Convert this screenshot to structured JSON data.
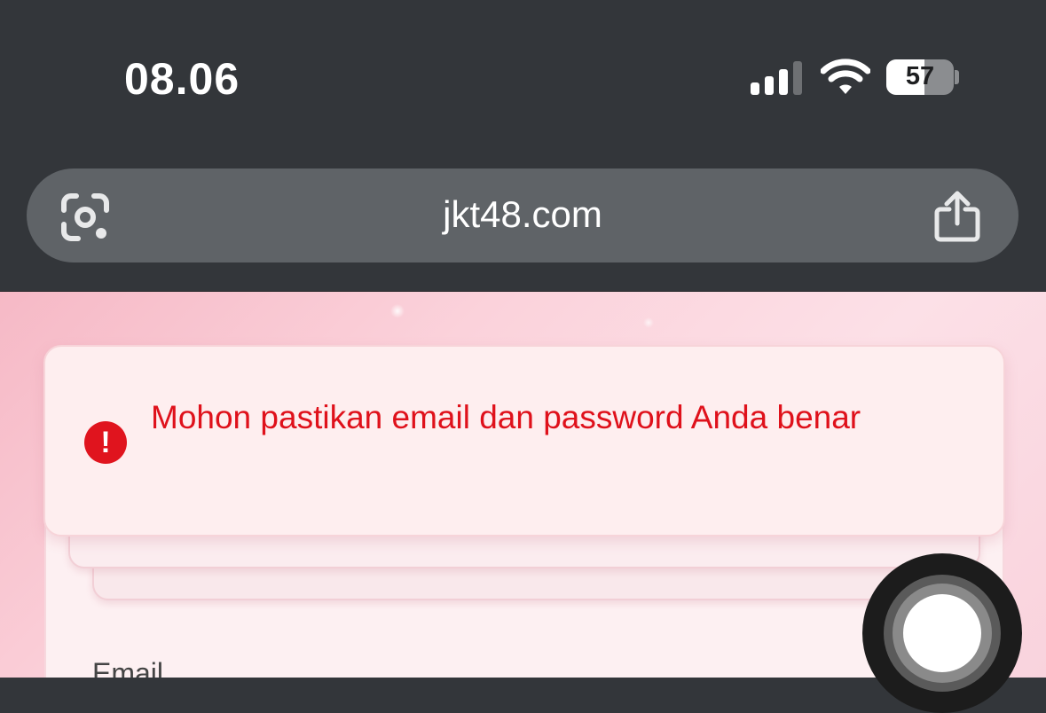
{
  "status_bar": {
    "time": "08.06",
    "battery_percent": "57",
    "battery_level": 0.57,
    "signal_icon": "cellular-signal-icon",
    "wifi_icon": "wifi-icon"
  },
  "browser": {
    "url": "jkt48.com",
    "lens_icon": "google-lens-icon",
    "share_icon": "share-icon"
  },
  "page": {
    "alert": {
      "message": "Mohon pastikan email dan password Anda benar",
      "icon": "error-exclamation-icon",
      "color": "#df111b"
    },
    "form": {
      "email_label": "Email"
    }
  },
  "overlay": {
    "assistive_touch_icon": "assistive-touch-icon"
  }
}
